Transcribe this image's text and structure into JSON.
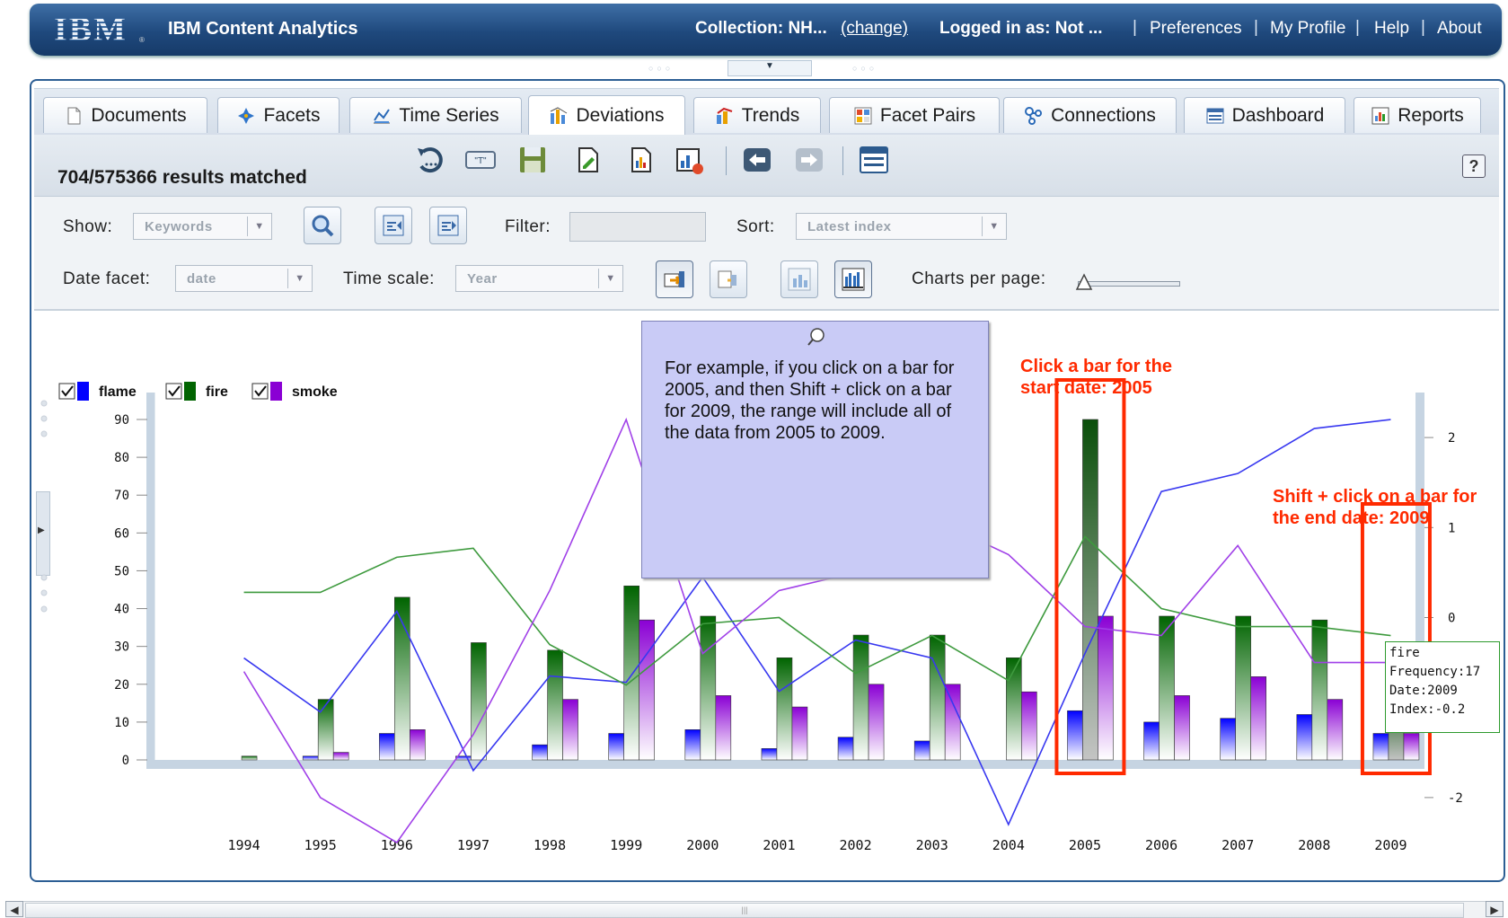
{
  "header": {
    "logo": "IBM",
    "app_title": "IBM Content Analytics",
    "collection_label": "Collection: NH...",
    "change_link": "(change)",
    "logged_in": "Logged in as: Not ...",
    "links": [
      "Preferences",
      "My Profile",
      "Help",
      "About"
    ]
  },
  "tabs": [
    {
      "label": "Documents",
      "icon": "document-icon"
    },
    {
      "label": "Facets",
      "icon": "facets-icon"
    },
    {
      "label": "Time Series",
      "icon": "time-series-icon"
    },
    {
      "label": "Deviations",
      "icon": "deviations-icon",
      "active": true
    },
    {
      "label": "Trends",
      "icon": "trends-icon"
    },
    {
      "label": "Facet Pairs",
      "icon": "facet-pairs-icon"
    },
    {
      "label": "Connections",
      "icon": "connections-icon"
    },
    {
      "label": "Dashboard",
      "icon": "dashboard-icon"
    },
    {
      "label": "Reports",
      "icon": "reports-icon"
    }
  ],
  "toolbar": {
    "results": "704/575366 results matched",
    "help": "?"
  },
  "options": {
    "show_label": "Show:",
    "show_value": "Keywords",
    "filter_label": "Filter:",
    "filter_value": "",
    "sort_label": "Sort:",
    "sort_value": "Latest index",
    "date_facet_label": "Date facet:",
    "date_facet_value": "date",
    "time_scale_label": "Time scale:",
    "time_scale_value": "Year",
    "charts_per_page_label": "Charts per page:"
  },
  "tooltip": {
    "text": "For example, if you click on a bar for 2005, and then Shift + click on a bar for 2009, the range will include all of the data from 2005 to 2009."
  },
  "annotations": {
    "start": [
      "Click a bar for the",
      "start date: 2005"
    ],
    "end": [
      "Shift + click on a bar for",
      "the end date: 2009"
    ]
  },
  "datatip": {
    "lines": [
      "fire",
      "Frequency:17",
      "Date:2009",
      "Index:-0.2"
    ]
  },
  "colors": {
    "flame": "#0000ff",
    "fire": "#006400",
    "smoke": "#8a00d4",
    "highlight": "#ff2a00"
  },
  "chart_data": {
    "type": "bar",
    "categories": [
      "1994",
      "1995",
      "1996",
      "1997",
      "1998",
      "1999",
      "2000",
      "2001",
      "2002",
      "2003",
      "2004",
      "2005",
      "2006",
      "2007",
      "2008",
      "2009"
    ],
    "series": [
      {
        "name": "flame",
        "values": [
          0,
          1,
          7,
          1,
          4,
          7,
          8,
          3,
          6,
          5,
          0,
          13,
          10,
          11,
          12,
          7
        ]
      },
      {
        "name": "fire",
        "values": [
          1,
          16,
          43,
          31,
          29,
          46,
          38,
          27,
          33,
          33,
          27,
          90,
          38,
          38,
          37,
          17
        ]
      },
      {
        "name": "smoke",
        "values": [
          0,
          2,
          8,
          0,
          16,
          37,
          17,
          14,
          20,
          20,
          18,
          38,
          17,
          22,
          16,
          7
        ]
      }
    ],
    "index_lines": [
      {
        "name": "flame",
        "values": [
          -0.45,
          -1.05,
          0.07,
          -1.7,
          -0.65,
          -0.72,
          0.45,
          -0.82,
          -0.25,
          -0.45,
          -2.3,
          -0.4,
          1.4,
          1.6,
          2.1,
          2.2
        ]
      },
      {
        "name": "fire",
        "values": [
          0.28,
          0.28,
          0.67,
          0.77,
          -0.3,
          -0.75,
          -0.07,
          0,
          -0.62,
          -0.2,
          -0.7,
          0.9,
          0.1,
          -0.1,
          -0.1,
          -0.2
        ]
      },
      {
        "name": "smoke",
        "values": [
          -0.6,
          -2,
          -2.5,
          -1.3,
          0.3,
          2.2,
          -0.4,
          0.3,
          0.5,
          1.1,
          0.7,
          -0.1,
          -0.2,
          0.8,
          -0.5,
          -0.5
        ]
      }
    ],
    "y_left": {
      "ylim": [
        0,
        90
      ],
      "ticks": [
        0,
        10,
        20,
        30,
        40,
        50,
        60,
        70,
        80,
        90
      ]
    },
    "y_right": {
      "ylim": [
        -2.5,
        2.5
      ],
      "ticks": [
        2,
        1,
        0,
        -1,
        -2
      ],
      "tick_labels": [
        "2",
        "1",
        "0",
        "",
        "-2"
      ]
    },
    "legend": [
      "flame",
      "fire",
      "smoke"
    ],
    "legend_placement": "top-left",
    "grid": false
  }
}
